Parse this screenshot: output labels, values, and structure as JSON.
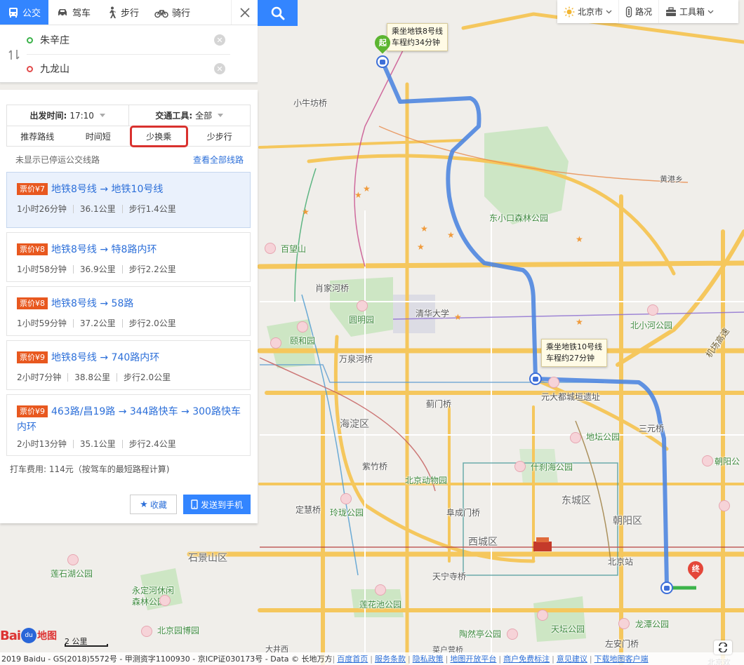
{
  "topbar": {
    "modes": [
      {
        "label": "公交",
        "icon": "bus-icon",
        "active": true
      },
      {
        "label": "驾车",
        "icon": "car-icon"
      },
      {
        "label": "步行",
        "icon": "walk-icon"
      },
      {
        "label": "骑行",
        "icon": "bike-icon"
      }
    ]
  },
  "route": {
    "start": "朱辛庄",
    "end": "九龙山"
  },
  "filters": {
    "depart_label": "出发时间:",
    "depart_value": "17:10",
    "vehicle_label": "交通工具:",
    "vehicle_value": "全部",
    "tabs": [
      "推荐路线",
      "时间短",
      "少换乘",
      "少步行"
    ],
    "selected_tab": "少换乘"
  },
  "notice": "未显示已停运公交线路",
  "view_all": "查看全部线路",
  "routes": [
    {
      "fare": "票价¥7",
      "title": "地铁8号线 → 地铁10号线",
      "duration": "1小时26分钟",
      "distance": "36.1公里",
      "walk": "步行1.4公里"
    },
    {
      "fare": "票价¥8",
      "title": "地铁8号线 → 特8路内环",
      "duration": "1小时58分钟",
      "distance": "36.9公里",
      "walk": "步行2.2公里"
    },
    {
      "fare": "票价¥8",
      "title": "地铁8号线 → 58路",
      "duration": "1小时59分钟",
      "distance": "37.2公里",
      "walk": "步行2.0公里"
    },
    {
      "fare": "票价¥9",
      "title": "地铁8号线 → 740路内环",
      "duration": "2小时7分钟",
      "distance": "38.8公里",
      "walk": "步行2.0公里"
    },
    {
      "fare": "票价¥9",
      "title": "463路/昌19路 → 344路快车 → 300路快车内环",
      "duration": "2小时13分钟",
      "distance": "35.1公里",
      "walk": "步行2.4公里"
    }
  ],
  "taxi_note": "打车费用: 114元（按驾车的最短路程计算)",
  "buttons": {
    "favorite": "收藏",
    "send": "发送到手机"
  },
  "toolbar": {
    "city": "北京市",
    "traffic": "路况",
    "toolbox": "工具箱"
  },
  "map": {
    "callout_start": [
      "乘坐地铁8号线",
      "车程约34分钟"
    ],
    "callout_transfer": [
      "乘坐地铁10号线",
      "车程约27分钟"
    ],
    "pin_start": "起",
    "pin_end": "终",
    "labels": [
      "小牛坊桥",
      "东小口森林公园",
      "黄港乡",
      "百望山",
      "肖家河桥",
      "清华大学",
      "圆明园",
      "颐和园",
      "万泉河桥",
      "北小河公园",
      "元大都城垣遗址",
      "蓟门桥",
      "海淀区",
      "三元桥",
      "地坛公园",
      "朝阳公",
      "紫竹桥",
      "北京动物园",
      "什刹海公园",
      "东城区",
      "定慧桥",
      "玲珑公园",
      "阜成门桥",
      "朝阳区",
      "西城区",
      "石景山区",
      "北京站",
      "莲石湖公园",
      "天宁寺桥",
      "永定河休闲森林公园",
      "莲花池公园",
      "北京园博园",
      "陶然亭公园",
      "天坛公园",
      "龙潭公园",
      "左安门桥",
      "北京欢",
      "大井西",
      "菜户营桥",
      "机场高速"
    ]
  },
  "scale_label": "2 公里",
  "logo": {
    "text": "Bai",
    "paw": "du",
    "suffix": "地图"
  },
  "copyright": {
    "text": "2019 Baidu - GS(2018)5572号 - 甲测资字1100930 - 京ICP证030173号 - Data © 长地万方",
    "links": [
      "百度首页",
      "服务条款",
      "隐私政策",
      "地图开放平台",
      "商户免费标注",
      "意见建议",
      "下载地图客户端"
    ]
  },
  "colors": {
    "accent": "#3385ff",
    "route_line": "#4f86e0",
    "fare": "#e8581f",
    "highlight": "#d9312e"
  }
}
